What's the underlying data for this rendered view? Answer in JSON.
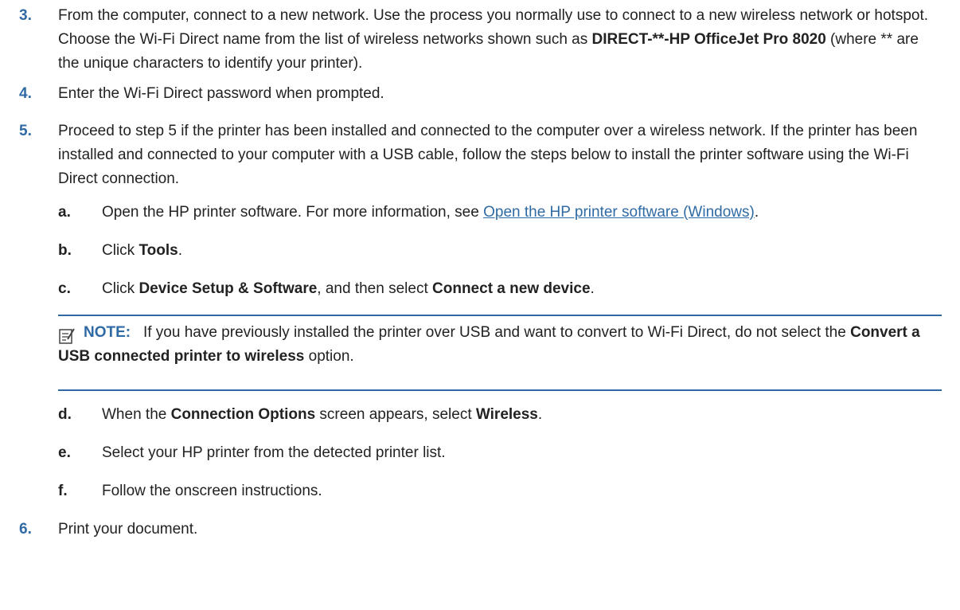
{
  "steps": [
    {
      "number": "3.",
      "parts": [
        "From the computer, connect to a new network. Use the process you normally use to connect to a new wireless network or hotspot. Choose the Wi-Fi Direct name from the list of wireless networks shown such as ",
        "DIRECT-**-HP OfficeJet Pro 8020",
        " (where ** are the unique characters to identify your printer)."
      ]
    },
    {
      "number": "4.",
      "text": "Enter the Wi-Fi Direct password when prompted."
    },
    {
      "number": "5.",
      "text": "Proceed to step 5 if the printer has been installed and connected to the computer over a wireless network. If the printer has been installed and connected to your computer with a USB cable, follow the steps below to install the printer software using the Wi-Fi Direct connection."
    },
    {
      "number": "6.",
      "text": "Print your document."
    }
  ],
  "substeps": {
    "a": {
      "letter": "a.",
      "text_before": "Open the HP printer software. For more information, see ",
      "link": "Open the HP printer software (Windows)",
      "text_after": "."
    },
    "b": {
      "letter": "b.",
      "text_before": "Click ",
      "bold": "Tools",
      "text_after": "."
    },
    "c": {
      "letter": "c.",
      "text_before": "Click ",
      "bold1": "Device Setup & Software",
      "text_middle": ", and then select ",
      "bold2": "Connect a new device",
      "text_after": "."
    },
    "d": {
      "letter": "d.",
      "text_before": "When the ",
      "bold1": "Connection Options",
      "text_middle": " screen appears, select ",
      "bold2": "Wireless",
      "text_after": "."
    },
    "e": {
      "letter": "e.",
      "text": "Select your HP printer from the detected printer list."
    },
    "f": {
      "letter": "f.",
      "text": "Follow the onscreen instructions."
    }
  },
  "note": {
    "label": "NOTE:",
    "text_before": "If you have previously installed the printer over USB and want to convert to Wi-Fi Direct, do not select the ",
    "bold": "Convert a USB connected printer to wireless",
    "text_after": " option.",
    "icon": "note-icon"
  },
  "colors": {
    "accent": "#2f6aa5",
    "text": "#222222"
  }
}
